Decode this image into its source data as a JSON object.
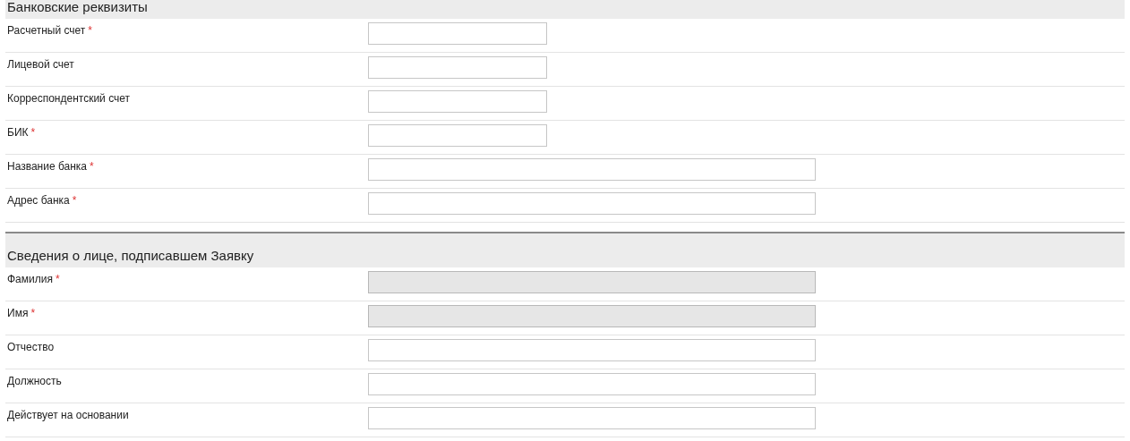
{
  "sections": [
    {
      "title": "Банковские реквизиты",
      "fields": [
        {
          "label": "Расчетный счет",
          "marker": "*",
          "kind": "short",
          "disabled": false
        },
        {
          "label": "Лицевой счет",
          "kind": "short",
          "disabled": false
        },
        {
          "label": "Корреспондентский счет",
          "kind": "short",
          "disabled": false
        },
        {
          "label": "БИК",
          "marker": "*",
          "kind": "short",
          "disabled": false
        },
        {
          "label": "Название банка",
          "marker": "*",
          "kind": "long",
          "disabled": false
        },
        {
          "label": "Адрес банка",
          "marker": "*",
          "kind": "long",
          "disabled": false
        }
      ]
    },
    {
      "title": "Сведения о лице, подписавшем Заявку",
      "fields": [
        {
          "label": "Фамилия",
          "marker": "*",
          "kind": "long",
          "disabled": true
        },
        {
          "label": "Имя",
          "marker": "*",
          "kind": "long",
          "disabled": true
        },
        {
          "label": "Отчество",
          "kind": "long",
          "disabled": false
        },
        {
          "label": "Должность",
          "kind": "long",
          "disabled": false
        },
        {
          "label": "Действует на основании",
          "kind": "long",
          "disabled": false
        }
      ]
    }
  ]
}
